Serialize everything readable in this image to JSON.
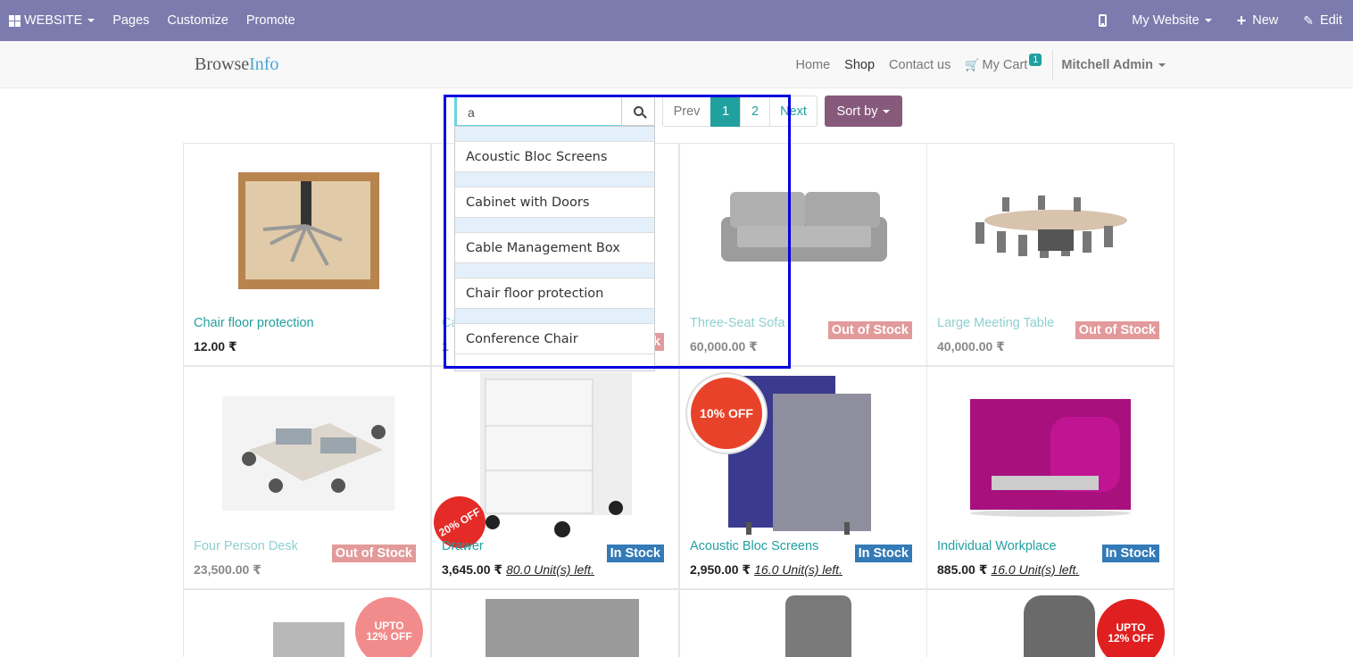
{
  "admin_bar": {
    "website": "WEBSITE",
    "pages": "Pages",
    "customize": "Customize",
    "promote": "Promote",
    "my_website": "My Website",
    "new": "New",
    "edit": "Edit"
  },
  "header": {
    "logo_browse": "Browse",
    "logo_info": "Info",
    "nav": {
      "home": "Home",
      "shop": "Shop",
      "contact": "Contact us",
      "cart": "My Cart",
      "cart_count": "1",
      "user": "Mitchell Admin"
    }
  },
  "search": {
    "value": "a"
  },
  "pager": {
    "prev": "Prev",
    "pages": [
      "1",
      "2"
    ],
    "next": "Next"
  },
  "sort": {
    "label": "Sort by"
  },
  "autocomplete": {
    "items": [
      "Acoustic Bloc Screens",
      "Cabinet with Doors",
      "Cable Management Box",
      "Chair floor protection",
      "Conference Chair"
    ]
  },
  "products": [
    {
      "name": "Chair floor protection",
      "price": "12.00 ₹",
      "stock": ""
    },
    {
      "name": "Ca",
      "price": "1",
      "stock": "k"
    },
    {
      "name": "Three-Seat Sofa",
      "price": "60,000.00 ₹",
      "stock": "Out of Stock"
    },
    {
      "name": "Large Meeting Table",
      "price": "40,000.00 ₹",
      "stock": "Out of Stock"
    },
    {
      "name": "Four Person Desk",
      "price": "23,500.00 ₹",
      "stock": "Out of Stock"
    },
    {
      "name": "Drawer",
      "price": "3,645.00 ₹",
      "units": "80.0 Unit(s) left.",
      "stock": "In Stock"
    },
    {
      "name": "Acoustic Bloc Screens",
      "price": "2,950.00 ₹",
      "units": "16.0 Unit(s) left.",
      "stock": "In Stock"
    },
    {
      "name": "Individual Workplace",
      "price": "885.00 ₹",
      "units": "16.0 Unit(s) left.",
      "stock": "In Stock"
    }
  ],
  "ribbons": {
    "off10": "10% OFF",
    "off20": "20% OFF",
    "upto12": "UPTO 12% OFF"
  },
  "colors": {
    "admin_bar": "#7c7bad",
    "accent": "#21a0a0",
    "sort_button": "#875a7b",
    "in_stock": "#337ab7",
    "out_stock": "#e29a9a",
    "highlight": "#0000dd"
  }
}
